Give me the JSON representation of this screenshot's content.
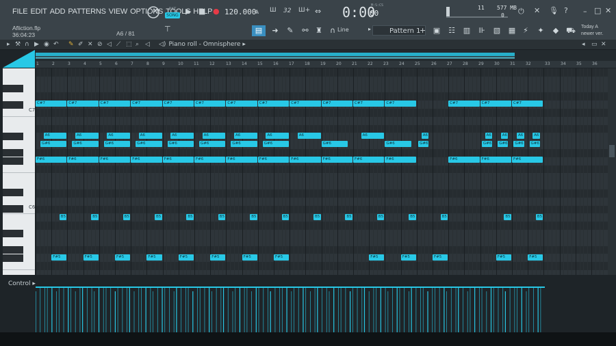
{
  "menu": [
    "FILE",
    "EDIT",
    "ADD",
    "PATTERNS",
    "VIEW",
    "OPTIONS",
    "TOOLS",
    "HELP"
  ],
  "project": {
    "name": "Afliction.flp",
    "time": "36:04:23",
    "hint": "A6 / 81"
  },
  "transport": {
    "pat_label": "PAT",
    "song_label": "SONG",
    "tempo": "120.000",
    "time": "0:00",
    "time_small": "00",
    "time_unit": "M:S:CS"
  },
  "cpu": {
    "voices": "11",
    "memory": "577 MB",
    "cpu_load": "0"
  },
  "snap": {
    "value": "Line"
  },
  "pattern": {
    "name": "Pattern 1"
  },
  "news": {
    "line1": "Today  A",
    "line2": "newer ver."
  },
  "piano_roll": {
    "title": "Piano roll - Omnisphere"
  },
  "ruler": [
    "1",
    "2",
    "3",
    "4",
    "5",
    "6",
    "7",
    "8",
    "9",
    "10",
    "11",
    "12",
    "13",
    "14",
    "15",
    "16",
    "17",
    "18",
    "19",
    "20",
    "21",
    "22",
    "23",
    "24",
    "25",
    "26",
    "27",
    "28",
    "29",
    "30",
    "31",
    "32",
    "33",
    "34",
    "35",
    "36"
  ],
  "keys": {
    "c7": "C7",
    "c6": "C6"
  },
  "notes": {
    "cs7": "C#7",
    "a6": "A6",
    "gs6": "G#6",
    "fs6": "F#6",
    "b5": "B5",
    "fs5": "F#5"
  },
  "control": {
    "label": "Control"
  },
  "colors": {
    "note": "#28c8e6",
    "accent": "#28c8e6"
  }
}
